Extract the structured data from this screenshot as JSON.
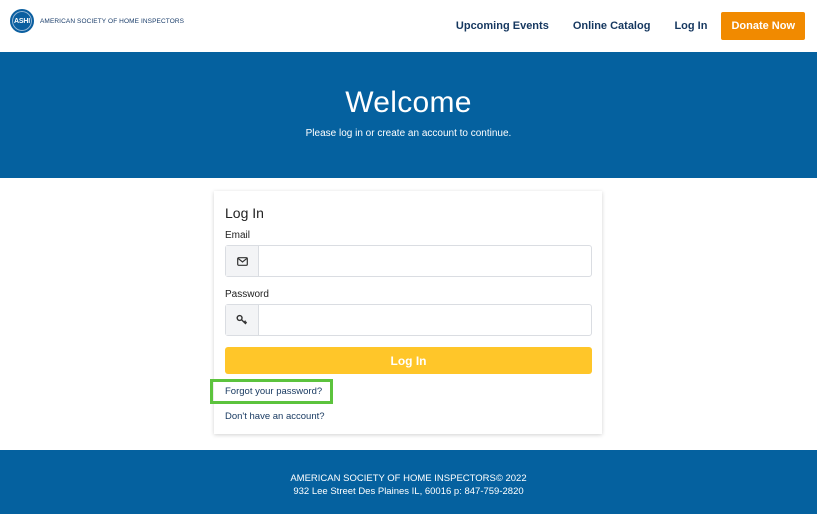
{
  "header": {
    "logo_mark": "ASHI",
    "logo_text": "American Society of Home Inspectors",
    "nav": {
      "upcoming_events": "Upcoming Events",
      "online_catalog": "Online Catalog",
      "log_in": "Log In",
      "donate": "Donate Now"
    },
    "colors": {
      "nav_text": "#15375f",
      "donate_bg": "#f18a00"
    }
  },
  "hero": {
    "title": "Welcome",
    "subtitle": "Please log in or create an account to continue.",
    "bg_color": "#05619f"
  },
  "login_card": {
    "title": "Log In",
    "email_label": "Email",
    "email_value": "",
    "email_icon": "envelope-icon",
    "password_label": "Password",
    "password_value": "",
    "password_icon": "key-icon",
    "submit_label": "Log In",
    "submit_color": "#ffc629",
    "forgot_link": "Forgot your password?",
    "forgot_highlight_color": "#5cc33d",
    "signup_link": "Don't have an account?"
  },
  "footer": {
    "line1": "AMERICAN SOCIETY OF HOME INSPECTORS© 2022",
    "line2": "932 Lee Street Des Plaines IL, 60016 p: 847-759-2820"
  }
}
